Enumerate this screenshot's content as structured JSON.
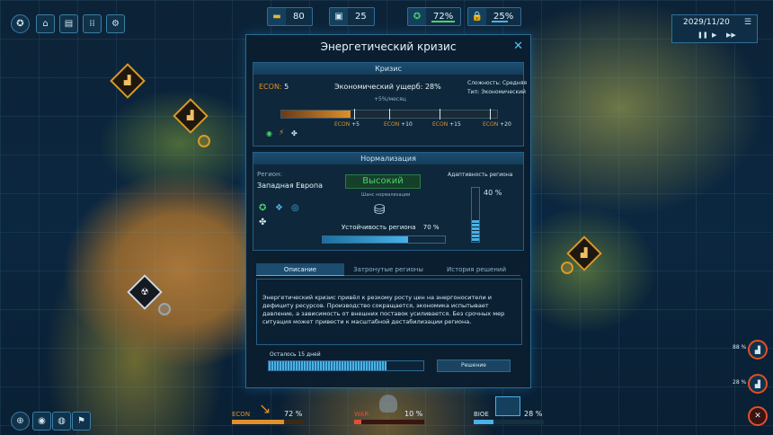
{
  "resources": {
    "r1": "80",
    "r2": "25",
    "approval": "72%",
    "lock": "25%"
  },
  "date": "2029/11/20",
  "modal": {
    "title": "Энергетический кризис",
    "crisis": {
      "header": "Кризис",
      "econ_label": "ECON:",
      "econ_value": "5",
      "damage_label": "Экономический ущерб:",
      "damage_value": "28%",
      "rate": "+5%/месяц",
      "difficulty": "Сложность: Средняя",
      "type": "Тип: Экономический",
      "progress": 0.32,
      "ticks": [
        {
          "tag": "ECON",
          "val": "+5"
        },
        {
          "tag": "ECON",
          "val": "+10"
        },
        {
          "tag": "ECON",
          "val": "+15"
        },
        {
          "tag": "ECON",
          "val": "+20"
        }
      ]
    },
    "normalization": {
      "header": "Нормализация",
      "region_label": "Регион:",
      "region_name": "Западная Европа",
      "chance_value": "Высокий",
      "chance_label": "Шанс нормализации",
      "stability_label": "Устойчивость региона",
      "stability_value": "70 %",
      "stability": 0.7,
      "adapt_label": "Адаптивность региона",
      "adapt_value": "40 %",
      "adapt": 0.4
    },
    "tabs": [
      "Описание",
      "Затронутые регионы",
      "История решений"
    ],
    "description": "Энергетический кризис привёл к резкому росту цен на энергоносители и дефициту ресурсов. Производство сокращается, экономика испытывает давление, а зависимость от внешних поставок усиливается. Без срочных мер ситуация может привести к масштабной дестабилизации региона.",
    "remaining": "Осталось 15 дней",
    "remaining_progress": 0.76,
    "decision_button": "Решение"
  },
  "bottom": {
    "econ": {
      "label": "ECON",
      "value": "72 %",
      "level": 0.72
    },
    "war": {
      "label": "WAR",
      "value": "10 %",
      "level": 0.1
    },
    "bio": {
      "label": "BIOE",
      "value": "28 %",
      "level": 0.28
    }
  },
  "right_indicators": [
    "88 %",
    "28 %"
  ],
  "colors": {
    "accent": "#4ab2e6",
    "warning": "#e0902a",
    "success": "#4cd46a",
    "danger": "#e0503a"
  }
}
